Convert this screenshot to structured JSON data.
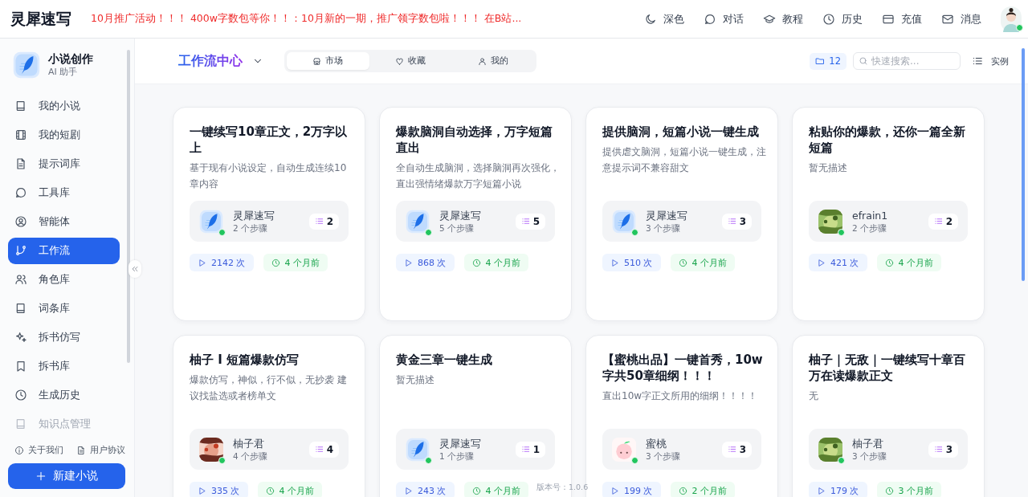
{
  "app": {
    "title": "灵犀速写"
  },
  "announcement": "10月推广活动！！！ 400w字数包等你！！：10月新的一期，推广领字数包啦！！！ 在B站...",
  "top_actions": [
    {
      "kind": "moon",
      "label": "深色"
    },
    {
      "kind": "chat",
      "label": "对话"
    },
    {
      "kind": "cap",
      "label": "教程"
    },
    {
      "kind": "clock",
      "label": "历史"
    },
    {
      "kind": "card",
      "label": "充值"
    },
    {
      "kind": "mail",
      "label": "消息"
    }
  ],
  "user": {
    "online": true
  },
  "sidebar": {
    "title": "小说创作",
    "subtitle": "AI 助手",
    "items": [
      {
        "kind": "book",
        "label": "我的小说",
        "selected": false,
        "faded": false
      },
      {
        "kind": "film",
        "label": "我的短剧",
        "selected": false,
        "faded": false
      },
      {
        "kind": "doc",
        "label": "提示词库",
        "selected": false,
        "faded": false
      },
      {
        "kind": "chat",
        "label": "工具库",
        "selected": false,
        "faded": false
      },
      {
        "kind": "usercircle",
        "label": "智能体",
        "selected": false,
        "faded": false
      },
      {
        "kind": "branch",
        "label": "工作流",
        "selected": true,
        "faded": false
      },
      {
        "kind": "users",
        "label": "角色库",
        "selected": false,
        "faded": false
      },
      {
        "kind": "book",
        "label": "词条库",
        "selected": false,
        "faded": false
      },
      {
        "kind": "sparkle",
        "label": "拆书仿写",
        "selected": false,
        "faded": false
      },
      {
        "kind": "bookmark",
        "label": "拆书库",
        "selected": false,
        "faded": false
      },
      {
        "kind": "clock",
        "label": "生成历史",
        "selected": false,
        "faded": false
      },
      {
        "kind": "book",
        "label": "知识点管理",
        "selected": false,
        "faded": true
      }
    ],
    "links": [
      {
        "kind": "info",
        "label": "关于我们"
      },
      {
        "kind": "doc",
        "label": "用户协议"
      }
    ],
    "new_button": "新建小说"
  },
  "header": {
    "title": "工作流中心",
    "tabs": [
      {
        "kind": "store",
        "label": "市场",
        "selected": true
      },
      {
        "kind": "heart",
        "label": "收藏",
        "selected": false
      },
      {
        "kind": "person",
        "label": "我的",
        "selected": false
      }
    ],
    "count": "12",
    "search_placeholder": "快速搜索...",
    "view_label": "实例"
  },
  "cards": [
    {
      "title": "一键续写10章正文，2万字以上",
      "description": "基于现有小说设定，自动生成连续10章内容",
      "author": "灵犀速写",
      "kind": "logo",
      "online": true,
      "steps": "2 个步骤",
      "step_count": "2",
      "runs": "2142 次",
      "updated": "4 个月前"
    },
    {
      "title": "爆款脑洞自动选择，万字短篇直出",
      "description": "全自动生成脑洞，选择脑洞再次强化，直出强情绪爆款万字短篇小说",
      "author": "灵犀速写",
      "kind": "logo",
      "online": true,
      "steps": "5 个步骤",
      "step_count": "5",
      "runs": "868 次",
      "updated": "4 个月前"
    },
    {
      "title": "提供脑洞，短篇小说一键生成",
      "description": "提供虐文脑洞，短篇小说一键生成，注意提示词不兼容甜文",
      "author": "灵犀速写",
      "kind": "logo",
      "online": true,
      "steps": "3 个步骤",
      "step_count": "3",
      "runs": "510 次",
      "updated": "4 个月前"
    },
    {
      "title": "粘贴你的爆款，还你一篇全新短篇",
      "description": "暂无描述",
      "author": "efrain1",
      "online": true,
      "steps": "2 个步骤",
      "step_count": "2",
      "runs": "421 次",
      "updated": "4 个月前"
    },
    {
      "title": "柚子 I 短篇爆款仿写",
      "description": "爆款仿写，神似，行不似，无抄袭 建议找盐选或者榜单文",
      "author": "柚子君",
      "online": true,
      "steps": "4 个步骤",
      "step_count": "4",
      "runs": "335 次",
      "updated": "4 个月前"
    },
    {
      "title": "黄金三章一键生成",
      "description": "暂无描述",
      "author": "灵犀速写",
      "kind": "logo",
      "online": true,
      "steps": "1 个步骤",
      "step_count": "1",
      "runs": "243 次",
      "updated": "4 个月前"
    },
    {
      "title": "【蜜桃出品】一键首秀，10w字共50章细纲！！！",
      "description": "直出10w字正文所用的细纲！！！！",
      "author": "蜜桃",
      "kind": "peach",
      "online": true,
      "steps": "3 个步骤",
      "step_count": "3",
      "runs": "199 次",
      "updated": "2 个月前"
    },
    {
      "title": "柚子｜无敌｜一键续写十章百万在读爆款正文",
      "description": "无",
      "author": "柚子君",
      "online": true,
      "steps": "3 个步骤",
      "step_count": "3",
      "runs": "179 次",
      "updated": "3 个月前"
    }
  ],
  "version": "版本号：1.0.6"
}
